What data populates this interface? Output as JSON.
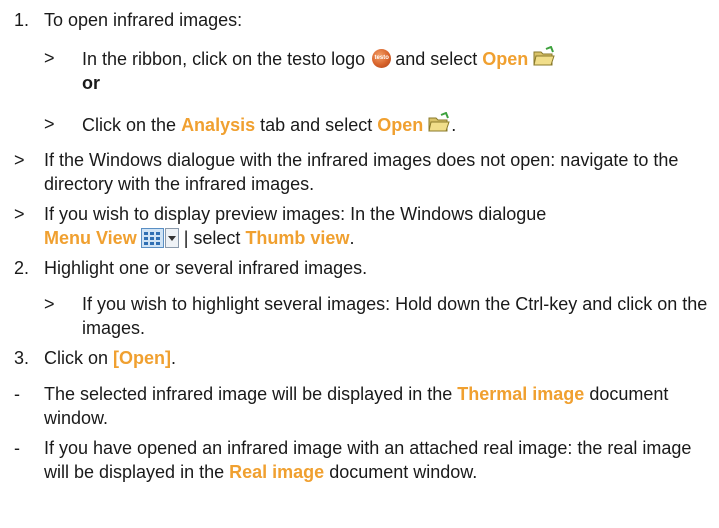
{
  "lines": {
    "l1": {
      "marker": "1.",
      "text": "To open infrared images:"
    },
    "l2": {
      "marker": ">",
      "a": "In the ribbon, click on the testo logo",
      "b": "and select",
      "open": "Open",
      "or": "or"
    },
    "l3": {
      "marker": ">",
      "a": "Click on the",
      "analysis": "Analysis",
      "b": "tab and select",
      "open": "Open",
      "end": "."
    },
    "l4": {
      "marker": ">",
      "text": "If the Windows dialogue with the infrared images does not open: navigate to the directory with the infrared images."
    },
    "l5": {
      "marker": ">",
      "a": "If you wish to display preview images: In the Windows dialogue",
      "menu_view": "Menu View",
      "b": "| select",
      "thumb": "Thumb view",
      "end": "."
    },
    "l6": {
      "marker": "2.",
      "text": "Highlight one or several infrared images."
    },
    "l7": {
      "marker": ">",
      "text": "If you wish to highlight several images: Hold down the Ctrl-key and click on the images."
    },
    "l8": {
      "marker": "3.",
      "a": "Click on",
      "open": "[Open]",
      "end": "."
    },
    "l9": {
      "marker": "-",
      "a": "The selected infrared image will be displayed in the",
      "thermal": "Thermal image",
      "b": "document window."
    },
    "l10": {
      "marker": "-",
      "a": "If you have opened an infrared image with an attached real image: the real image will be displayed in the",
      "real": "Real image",
      "b": "document window."
    }
  },
  "icons": {
    "testo_logo": {
      "name": "testo-logo-icon",
      "label": "testo"
    },
    "open_folder": {
      "name": "open-folder-icon"
    },
    "menu_view": {
      "name": "menu-view-icon"
    }
  },
  "colors": {
    "highlight": "#f0a030",
    "text": "#1a1a1a"
  }
}
